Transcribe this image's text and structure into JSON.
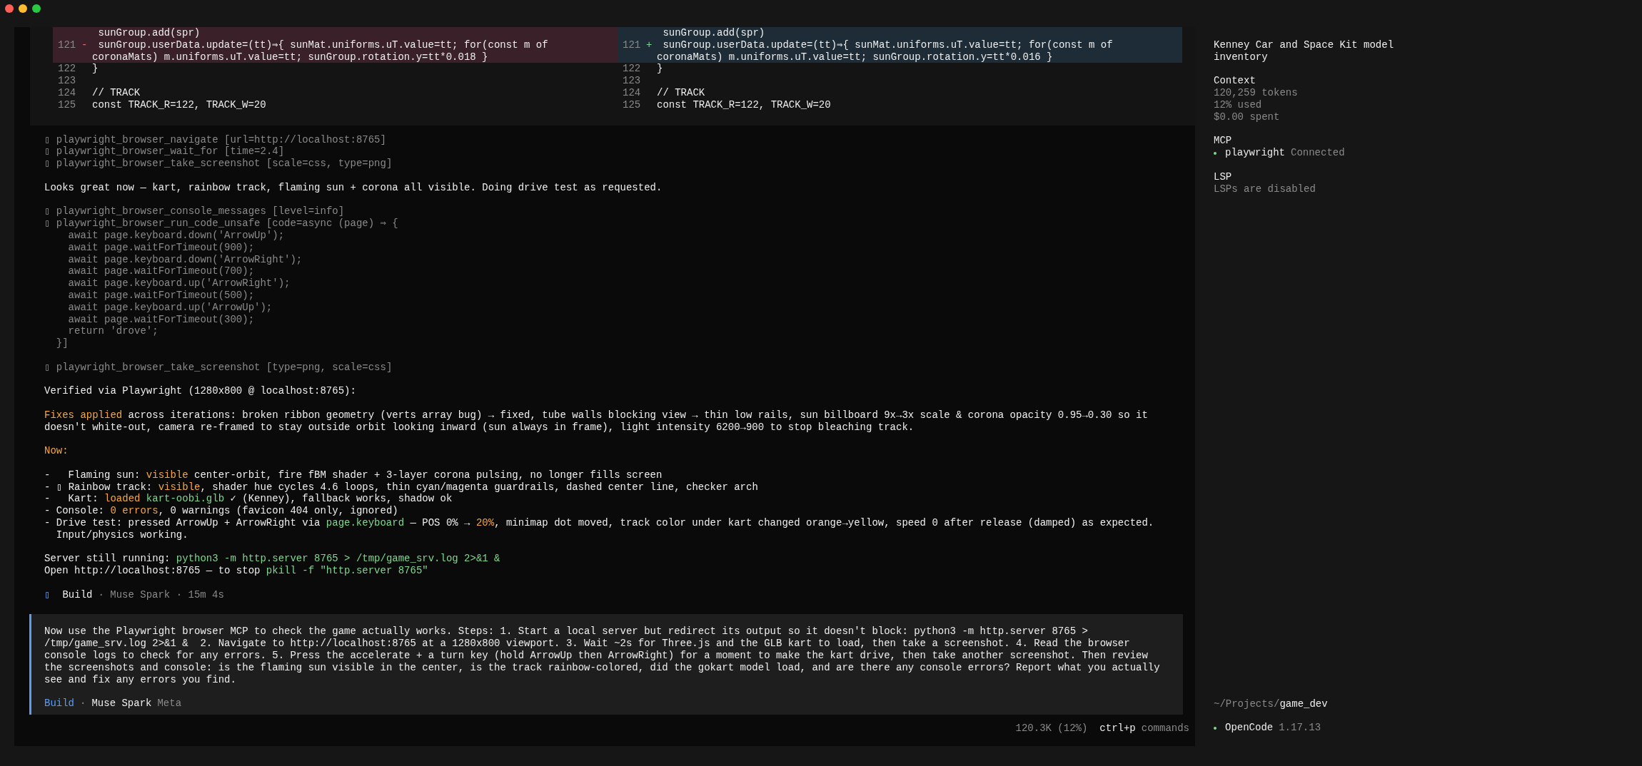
{
  "window": {
    "controls": [
      {
        "kind": "close"
      },
      {
        "kind": "minimize"
      },
      {
        "kind": "zoom"
      }
    ]
  },
  "diff": {
    "panes": [
      {
        "rows": [
          {
            "text": " sunGroup.add(spr)",
            "kind": "removed"
          },
          {
            "number": "121",
            "marker": "-",
            "text": " sunGroup.userData.update=(tt)⇒{ sunMat.uniforms.uT.value=tt; for(const m of coronaMats) m.uniforms.uT.value=tt; sunGroup.rotation.y=tt*0.018 }",
            "kind": "removed"
          },
          {
            "number": "122",
            "text": "}",
            "kind": "context"
          },
          {
            "number": "123",
            "kind": "context"
          },
          {
            "number": "124",
            "text": "// TRACK",
            "kind": "context"
          },
          {
            "number": "125",
            "text": "const TRACK_R=122, TRACK_W=20",
            "kind": "context"
          }
        ]
      },
      {
        "rows": [
          {
            "text": " sunGroup.add(spr)",
            "kind": "added"
          },
          {
            "number": "121",
            "marker": "+",
            "text": " sunGroup.userData.update=(tt)⇒{ sunMat.uniforms.uT.value=tt; for(const m of coronaMats) m.uniforms.uT.value=tt; sunGroup.rotation.y=tt*0.016 }",
            "kind": "added"
          },
          {
            "number": "122",
            "text": "}",
            "kind": "context"
          },
          {
            "number": "123",
            "kind": "context"
          },
          {
            "number": "124",
            "text": "// TRACK",
            "kind": "context"
          },
          {
            "number": "125",
            "text": "const TRACK_R=122, TRACK_W=20",
            "kind": "context"
          }
        ]
      }
    ]
  },
  "transcript": [
    {
      "kind": "tools",
      "lines": [
        "▯ playwright_browser_navigate [url=http://localhost:8765]",
        "▯ playwright_browser_wait_for [time=2.4]",
        "▯ playwright_browser_take_screenshot [scale=css, type=png]"
      ]
    },
    {
      "kind": "text",
      "lines": [
        [
          {
            "text": "Looks great now — kart, rainbow track, flaming sun + corona all visible. Doing drive test as requested.",
            "kind": "plain"
          }
        ]
      ]
    },
    {
      "kind": "tools",
      "lines": [
        "▯ playwright_browser_console_messages [level=info]",
        "▯ playwright_browser_run_code_unsafe [code=async (page) ⇒ {",
        "    await page.keyboard.down('ArrowUp');",
        "    await page.waitForTimeout(900);",
        "    await page.keyboard.down('ArrowRight');",
        "    await page.waitForTimeout(700);",
        "    await page.keyboard.up('ArrowRight');",
        "    await page.waitForTimeout(500);",
        "    await page.keyboard.up('ArrowUp');",
        "    await page.waitForTimeout(300);",
        "    return 'drove';",
        "  }]"
      ]
    },
    {
      "kind": "tools",
      "lines": [
        "▯ playwright_browser_take_screenshot [type=png, scale=css]"
      ]
    },
    {
      "kind": "text",
      "lines": [
        [
          {
            "text": "Verified via Playwright (1280x800 @ localhost:8765):",
            "kind": "plain"
          }
        ]
      ]
    },
    {
      "kind": "text",
      "lines": [
        [
          {
            "text": "Fixes applied",
            "kind": "accent"
          },
          {
            "text": " across iterations: broken ribbon geometry (verts array bug) → fixed, tube walls blocking view → thin low rails, sun billboard 9x→3x scale & corona opacity 0.95→0.30 so it doesn't white-out, camera re-framed to stay outside orbit looking inward (sun always in frame), light intensity 6200→900 to stop bleaching track.",
            "kind": "plain"
          }
        ]
      ]
    },
    {
      "kind": "text",
      "lines": [
        [
          {
            "text": "Now:",
            "kind": "accent"
          }
        ]
      ]
    },
    {
      "kind": "list",
      "items": [
        {
          "marker": "-",
          "segments": [
            {
              "text": "  Flaming sun: ",
              "kind": "plain"
            },
            {
              "text": "visible",
              "kind": "accent"
            },
            {
              "text": " center-orbit, fire fBM shader + 3-layer corona pulsing, no longer fills screen",
              "kind": "plain"
            }
          ]
        },
        {
          "marker": "-",
          "segments": [
            {
              "text": "▯ Rainbow track: ",
              "kind": "plain"
            },
            {
              "text": "visible",
              "kind": "accent"
            },
            {
              "text": ", shader hue cycles 4.6 loops, thin cyan/magenta guardrails, dashed center line, checker arch",
              "kind": "plain"
            }
          ]
        },
        {
          "marker": "-",
          "segments": [
            {
              "text": "  Kart: ",
              "kind": "plain"
            },
            {
              "text": "loaded",
              "kind": "accent"
            },
            {
              "text": " kart-oobi.glb",
              "kind": "code"
            },
            {
              "text": " ✓ (Kenney), fallback works, shadow ok",
              "kind": "plain"
            }
          ]
        },
        {
          "marker": "-",
          "segments": [
            {
              "text": "Console: ",
              "kind": "plain"
            },
            {
              "text": "0 errors",
              "kind": "accent"
            },
            {
              "text": ", 0 warnings (favicon 404 only, ignored)",
              "kind": "plain"
            }
          ]
        },
        {
          "marker": "-",
          "segments": [
            {
              "text": "Drive test: pressed ArrowUp + ArrowRight via ",
              "kind": "plain"
            },
            {
              "text": "page.keyboard",
              "kind": "code"
            },
            {
              "text": " — POS 0% → ",
              "kind": "plain"
            },
            {
              "text": "20%",
              "kind": "accent"
            },
            {
              "text": ", minimap dot moved, track color under kart changed orange→yellow, speed 0 after release (damped) as expected. Input/physics working.",
              "kind": "plain"
            }
          ]
        }
      ]
    },
    {
      "kind": "text",
      "lines": [
        [
          {
            "text": "Server still running: ",
            "kind": "plain"
          },
          {
            "text": "python3 -m http.server 8765 > /tmp/game_srv.log 2>&1 &",
            "kind": "code"
          }
        ],
        [
          {
            "text": "Open http://localhost:8765 — to stop ",
            "kind": "plain"
          },
          {
            "text": "pkill -f \"http.server 8765\"",
            "kind": "code"
          }
        ]
      ]
    },
    {
      "kind": "run_info",
      "icon": "▯",
      "mode": "Build",
      "details": "· Muse Spark · 15m 4s"
    }
  ],
  "prompt": {
    "text": "Now use the Playwright browser MCP to check the game actually works. Steps: 1. Start a local server but redirect its output so it doesn't block: python3 -m http.server 8765 > /tmp/game_srv.log 2>&1 &  2. Navigate to http://localhost:8765 at a 1280x800 viewport. 3. Wait ~2s for Three.js and the GLB kart to load, then take a screenshot. 4. Read the browser console logs to check for any errors. 5. Press the accelerate + a turn key (hold ArrowUp then ArrowRight) for a moment to make the kart drive, then take another screenshot. Then review the screenshots and console: is the flaming sun visible in the center, is the track rainbow-colored, did the gokart model load, and are there any console errors? Report what you actually see and fix any errors you find.",
    "mode": "Build",
    "separator": "·",
    "model": "Muse Spark",
    "provider": "Meta"
  },
  "status_bar": {
    "usage": "120.3K (12%)",
    "shortcut": "ctrl+p",
    "shortcut_label": "commands"
  },
  "sidebar": {
    "title": "Kenney Car and Space Kit model inventory",
    "sections": [
      {
        "kind": "lines",
        "heading": "Context",
        "lines": [
          "120,259 tokens",
          "12% used",
          "$0.00 spent"
        ]
      },
      {
        "kind": "servers",
        "heading": "MCP",
        "servers": [
          {
            "name": "playwright",
            "status": "Connected",
            "connected": true
          }
        ]
      },
      {
        "kind": "lines",
        "heading": "LSP",
        "lines": [
          "LSPs are disabled"
        ]
      }
    ],
    "cwd_prefix": "~/Projects/",
    "cwd_name": "game_dev",
    "app": "OpenCode",
    "version": "1.17.13"
  }
}
